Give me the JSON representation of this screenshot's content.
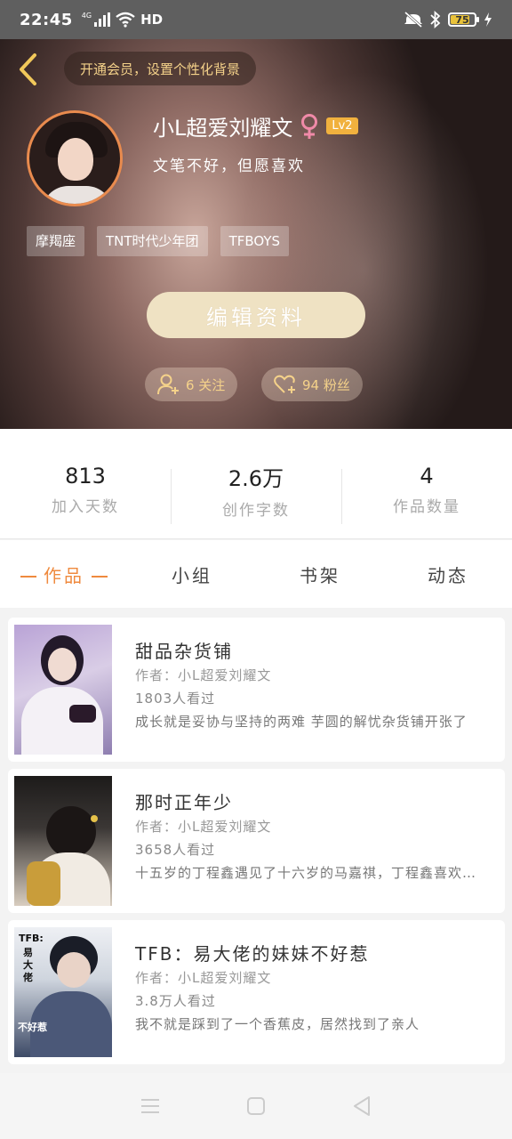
{
  "status_bar": {
    "time": "22:45",
    "network": "4G",
    "network_type": "HD",
    "battery": "75",
    "battery_level": 0.75,
    "icons": [
      "signal-icon",
      "wifi-icon",
      "mute-icon",
      "bluetooth-icon",
      "battery-icon",
      "charging-icon"
    ]
  },
  "header": {
    "vip_banner": "开通会员，设置个性化背景",
    "username": "小L超爱刘耀文",
    "gender_icon": "female-icon",
    "level": "Lv2",
    "bio": "文笔不好，但愿喜欢",
    "tags": [
      "摩羯座",
      "TNT时代少年团",
      "TFBOYS"
    ],
    "edit_button": "编辑资料",
    "following": "6 关注",
    "fans": "94 粉丝"
  },
  "stats": [
    {
      "value": "813",
      "label": "加入天数"
    },
    {
      "value": "2.6万",
      "label": "创作字数"
    },
    {
      "value": "4",
      "label": "作品数量"
    }
  ],
  "tabs": [
    {
      "label": "作品",
      "active": true
    },
    {
      "label": "小组",
      "active": false
    },
    {
      "label": "书架",
      "active": false
    },
    {
      "label": "动态",
      "active": false
    }
  ],
  "books": [
    {
      "title": "甜品杂货铺",
      "author": "作者：小L超爱刘耀文",
      "views": "1803人看过",
      "desc": "成长就是妥协与坚持的两难 芋圆的解忧杂货铺开张了"
    },
    {
      "title": "那时正年少",
      "author": "作者：小L超爱刘耀文",
      "views": "3658人看过",
      "desc": "十五岁的丁程鑫遇见了十六岁的马嘉祺，丁程鑫喜欢上了他"
    },
    {
      "title": "TFB：易大佬的妹妹不好惹",
      "author": "作者：小L超爱刘耀文",
      "views": "3.8万人看过",
      "desc": "我不就是踩到了一个香蕉皮，居然找到了亲人"
    }
  ],
  "cover3_text": {
    "line1": "TFB:",
    "line2": "易",
    "line3": "大",
    "line4": "佬",
    "line5": "不好惹"
  },
  "colors": {
    "accent": "#ef8a3e",
    "vip_text": "#f5d28a",
    "level_badge": "#f1b13e",
    "avatar_ring": "#e98b4e"
  }
}
